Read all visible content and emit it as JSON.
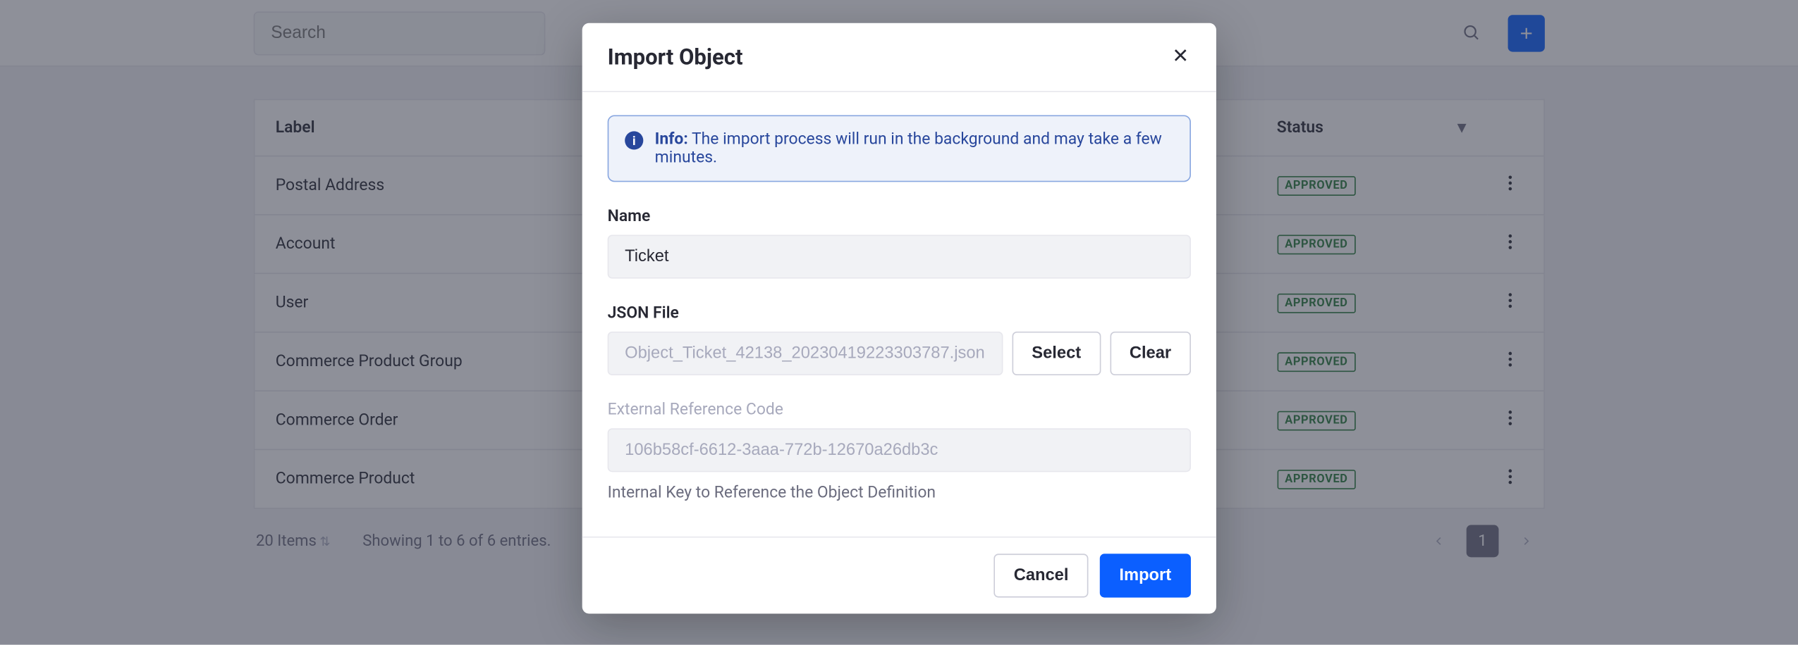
{
  "search": {
    "placeholder": "Search"
  },
  "table": {
    "columns": {
      "label": "Label",
      "status": "Status"
    },
    "rows": [
      {
        "label": "Postal Address",
        "status": "APPROVED"
      },
      {
        "label": "Account",
        "status": "APPROVED"
      },
      {
        "label": "User",
        "status": "APPROVED"
      },
      {
        "label": "Commerce Product Group",
        "status": "APPROVED"
      },
      {
        "label": "Commerce Order",
        "status": "APPROVED"
      },
      {
        "label": "Commerce Product",
        "status": "APPROVED"
      }
    ]
  },
  "footer": {
    "items": "20 Items",
    "showing": "Showing 1 to 6 of 6 entries.",
    "page": "1"
  },
  "modal": {
    "title": "Import Object",
    "alert_label": "Info:",
    "alert_text": "The import process will run in the background and may take a few minutes.",
    "name_label": "Name",
    "name_value": "Ticket",
    "json_label": "JSON File",
    "json_value": "Object_Ticket_42138_20230419223303787.json",
    "select_label": "Select",
    "clear_label": "Clear",
    "erc_label": "External Reference Code",
    "erc_value": "106b58cf-6612-3aaa-772b-12670a26db3c",
    "erc_hint": "Internal Key to Reference the Object Definition",
    "cancel_label": "Cancel",
    "import_label": "Import"
  }
}
